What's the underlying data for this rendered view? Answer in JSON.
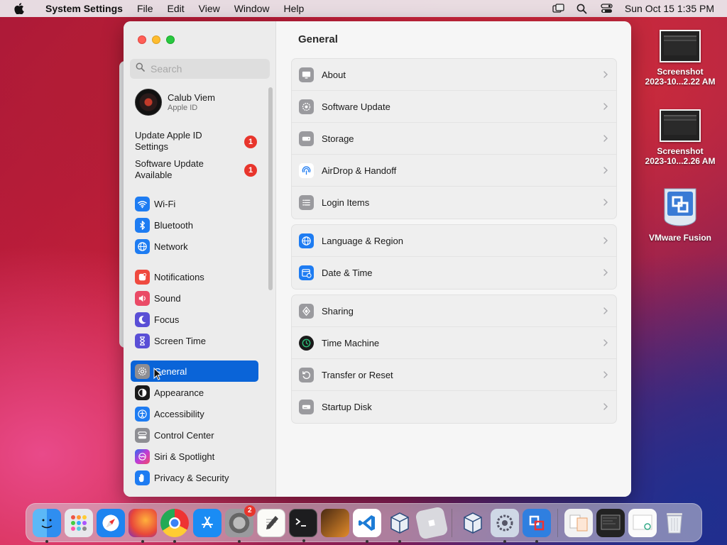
{
  "menubar": {
    "app_name": "System Settings",
    "items": [
      "File",
      "Edit",
      "View",
      "Window",
      "Help"
    ],
    "clock": "Sun Oct 15  1:35 PM"
  },
  "sidebar": {
    "search_placeholder": "Search",
    "account": {
      "name": "Calub Viem",
      "subtitle": "Apple ID"
    },
    "notices": [
      {
        "label": "Update Apple ID Settings",
        "badge": "1"
      },
      {
        "label": "Software Update Available",
        "badge": "1"
      }
    ],
    "items": [
      {
        "label": "Wi-Fi",
        "icon": "wifi-icon",
        "color": "#1e7cf2"
      },
      {
        "label": "Bluetooth",
        "icon": "bluetooth-icon",
        "color": "#1e7cf2"
      },
      {
        "label": "Network",
        "icon": "globe-icon",
        "color": "#1e7cf2"
      },
      {
        "label": "Notifications",
        "icon": "bell-icon",
        "color": "#ef4a3f"
      },
      {
        "label": "Sound",
        "icon": "speaker-icon",
        "color": "#ea4a66"
      },
      {
        "label": "Focus",
        "icon": "moon-icon",
        "color": "#5a4fd6"
      },
      {
        "label": "Screen Time",
        "icon": "hourglass-icon",
        "color": "#5a4fd6"
      },
      {
        "label": "General",
        "icon": "gear-icon",
        "color": "#8e8e93",
        "selected": true
      },
      {
        "label": "Appearance",
        "icon": "appearance-icon",
        "color": "#1a1a1a"
      },
      {
        "label": "Accessibility",
        "icon": "accessibility-icon",
        "color": "#1e7cf2"
      },
      {
        "label": "Control Center",
        "icon": "control-center-icon",
        "color": "#8e8e93"
      },
      {
        "label": "Siri & Spotlight",
        "icon": "siri-icon",
        "color": "#8a3cc8"
      },
      {
        "label": "Privacy & Security",
        "icon": "hand-icon",
        "color": "#1e7cf2"
      }
    ]
  },
  "content": {
    "title": "General",
    "groups": [
      [
        {
          "label": "About",
          "icon": "display-icon",
          "color": "#9a9a9e"
        },
        {
          "label": "Software Update",
          "icon": "gear-badge-icon",
          "color": "#9a9a9e"
        },
        {
          "label": "Storage",
          "icon": "drive-icon",
          "color": "#9a9a9e"
        },
        {
          "label": "AirDrop & Handoff",
          "icon": "airdrop-icon",
          "color": "#1e7cf2"
        },
        {
          "label": "Login Items",
          "icon": "list-icon",
          "color": "#9a9a9e"
        }
      ],
      [
        {
          "label": "Language & Region",
          "icon": "globe-icon",
          "color": "#1e7cf2"
        },
        {
          "label": "Date & Time",
          "icon": "calendar-clock-icon",
          "color": "#1e7cf2"
        }
      ],
      [
        {
          "label": "Sharing",
          "icon": "sharing-icon",
          "color": "#9a9a9e"
        },
        {
          "label": "Time Machine",
          "icon": "time-machine-icon",
          "color": "#1c8a5a"
        },
        {
          "label": "Transfer or Reset",
          "icon": "reset-icon",
          "color": "#9a9a9e"
        },
        {
          "label": "Startup Disk",
          "icon": "disk-icon",
          "color": "#9a9a9e"
        }
      ]
    ]
  },
  "desktop": [
    {
      "label_line1": "Screenshot",
      "label_line2": "2023-10...2.22 AM",
      "icon": "screenshot-thumbnail"
    },
    {
      "label_line1": "Screenshot",
      "label_line2": "2023-10...2.26 AM",
      "icon": "screenshot-thumbnail"
    },
    {
      "label_line1": "VMware Fusion",
      "label_line2": "",
      "icon": "vmware-fusion-icon"
    }
  ],
  "dock": {
    "apps": [
      {
        "name": "finder-icon",
        "running": true
      },
      {
        "name": "launchpad-icon",
        "running": false
      },
      {
        "name": "safari-icon",
        "running": false
      },
      {
        "name": "firefox-icon",
        "running": true
      },
      {
        "name": "chrome-icon",
        "running": true
      },
      {
        "name": "app-store-icon",
        "running": false
      },
      {
        "name": "system-settings-icon",
        "running": true,
        "badge": "2"
      },
      {
        "name": "textedit-icon",
        "running": false
      },
      {
        "name": "terminal-icon",
        "running": true
      },
      {
        "name": "garageband-icon",
        "running": false
      },
      {
        "name": "vscode-icon",
        "running": true
      },
      {
        "name": "virtualbox-icon",
        "running": true
      },
      {
        "name": "roblox-icon",
        "running": false
      },
      {
        "name": "virtualbox-manager-icon",
        "running": false
      },
      {
        "name": "system-preferences-icon",
        "running": true
      },
      {
        "name": "vmware-fusion-icon",
        "running": true
      },
      {
        "name": "downloads-stack-icon",
        "running": false
      },
      {
        "name": "documents-stack-icon",
        "running": false
      },
      {
        "name": "recents-stack-icon",
        "running": false
      },
      {
        "name": "trash-icon",
        "running": false
      }
    ]
  }
}
